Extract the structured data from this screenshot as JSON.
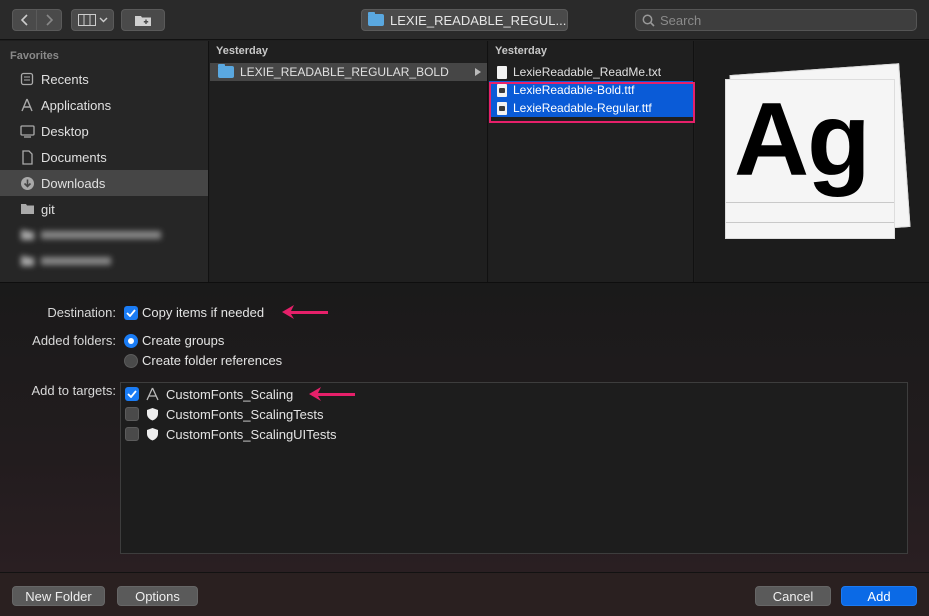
{
  "toolbar": {
    "path_label": "LEXIE_READABLE_REGUL...",
    "search_placeholder": "Search"
  },
  "sidebar": {
    "heading": "Favorites",
    "items": [
      {
        "label": "Recents",
        "icon": "clock-icon"
      },
      {
        "label": "Applications",
        "icon": "applications-icon"
      },
      {
        "label": "Desktop",
        "icon": "desktop-icon"
      },
      {
        "label": "Documents",
        "icon": "documents-icon"
      },
      {
        "label": "Downloads",
        "icon": "downloads-icon",
        "selected": true
      },
      {
        "label": "git",
        "icon": "folder-icon"
      }
    ]
  },
  "column1": {
    "header": "Yesterday",
    "items": [
      {
        "label": "LEXIE_READABLE_REGULAR_BOLD",
        "selected": true
      }
    ]
  },
  "column2": {
    "header": "Yesterday",
    "items": [
      {
        "label": "LexieReadable_ReadMe.txt"
      },
      {
        "label": "LexieReadable-Bold.ttf",
        "selected": true
      },
      {
        "label": "LexieReadable-Regular.ttf",
        "selected": true
      }
    ]
  },
  "preview": {
    "glyph_text": "Ag"
  },
  "options": {
    "destination_label": "Destination:",
    "copy_items_label": "Copy items if needed",
    "copy_items_checked": true,
    "added_folders_label": "Added folders:",
    "create_groups_label": "Create groups",
    "create_folder_refs_label": "Create folder references",
    "selected_folder_option": "Create groups",
    "add_to_targets_label": "Add to targets:",
    "targets": [
      {
        "label": "CustomFonts_Scaling",
        "checked": true,
        "icon": "app-target-icon"
      },
      {
        "label": "CustomFonts_ScalingTests",
        "checked": false,
        "icon": "shield-icon"
      },
      {
        "label": "CustomFonts_ScalingUITests",
        "checked": false,
        "icon": "shield-icon"
      }
    ]
  },
  "buttons": {
    "new_folder": "New Folder",
    "options": "Options",
    "cancel": "Cancel",
    "add": "Add"
  },
  "colors": {
    "accent": "#1a7cf5",
    "selection_blue": "#0a5bd7",
    "annotation_pink": "#e6206a"
  }
}
